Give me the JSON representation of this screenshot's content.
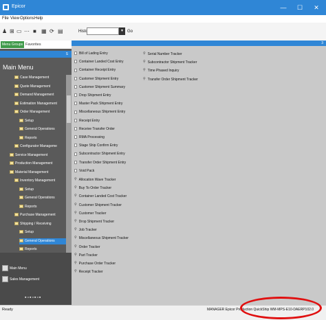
{
  "window": {
    "title": "Epicor",
    "controls": [
      "—",
      "☐",
      "✕"
    ]
  },
  "menubar": [
    "File",
    "View",
    "Options",
    "Help"
  ],
  "toolbar": {
    "icons": [
      "user-icon",
      "tree-icon",
      "window-icon",
      "dots-icon",
      "save-icon",
      "grid-icon",
      "refresh-icon",
      "clipboard-icon"
    ],
    "history_label": "History:",
    "history_value": "",
    "go_label": "Go"
  },
  "left_panel": {
    "tabs": [
      "Menu Groups",
      "Favorites"
    ],
    "blue_bar_text": "S",
    "title": "Main Menu",
    "tree": [
      {
        "label": "Case Management",
        "indent": 3,
        "selected": false
      },
      {
        "label": "Quote Management",
        "indent": 3,
        "selected": false
      },
      {
        "label": "Demand Management",
        "indent": 3,
        "selected": false
      },
      {
        "label": "Estimation Management",
        "indent": 3,
        "selected": false
      },
      {
        "label": "Order Management",
        "indent": 3,
        "selected": false
      },
      {
        "label": "Setup",
        "indent": 4,
        "selected": false
      },
      {
        "label": "General Operations",
        "indent": 4,
        "selected": false
      },
      {
        "label": "Reports",
        "indent": 4,
        "selected": false
      },
      {
        "label": "Configurator Manageme",
        "indent": 3,
        "selected": false
      },
      {
        "label": "Service Management",
        "indent": 2,
        "selected": false
      },
      {
        "label": "Production Management",
        "indent": 2,
        "selected": false
      },
      {
        "label": "Material Management",
        "indent": 2,
        "selected": false
      },
      {
        "label": "Inventory Management",
        "indent": 3,
        "selected": false
      },
      {
        "label": "Setup",
        "indent": 4,
        "selected": false
      },
      {
        "label": "General Operations",
        "indent": 4,
        "selected": false
      },
      {
        "label": "Reports",
        "indent": 4,
        "selected": false
      },
      {
        "label": "Purchase Management",
        "indent": 3,
        "selected": false
      },
      {
        "label": "Shipping / Receiving",
        "indent": 3,
        "selected": false
      },
      {
        "label": "Setup",
        "indent": 4,
        "selected": false
      },
      {
        "label": "General Operations",
        "indent": 4,
        "selected": true
      },
      {
        "label": "Reports",
        "indent": 4,
        "selected": false
      }
    ],
    "bottom_items": [
      "Main Menu",
      "Sales Management"
    ]
  },
  "right_panel": {
    "blue_bar_text": "3",
    "column1": [
      {
        "label": "Bill of Lading Entry",
        "icon": "doc"
      },
      {
        "label": "Container Landed Cost Entry",
        "icon": "doc"
      },
      {
        "label": "Container Receipt Entry",
        "icon": "doc"
      },
      {
        "label": "Customer Shipment Entry",
        "icon": "doc"
      },
      {
        "label": "Customer Shipment Summary",
        "icon": "doc"
      },
      {
        "label": "Drop Shipment Entry",
        "icon": "doc"
      },
      {
        "label": "Master Pack Shipment Entry",
        "icon": "doc"
      },
      {
        "label": "Miscellaneous Shipment Entry",
        "icon": "doc"
      },
      {
        "label": "Receipt Entry",
        "icon": "doc"
      },
      {
        "label": "Receive Transfer Order",
        "icon": "doc"
      },
      {
        "label": "RMA Processing",
        "icon": "doc"
      },
      {
        "label": "Stage Ship Confirm Entry",
        "icon": "doc"
      },
      {
        "label": "Subcontractor Shipment Entry",
        "icon": "doc"
      },
      {
        "label": "Transfer Order Shipment Entry",
        "icon": "doc"
      },
      {
        "label": "Void Pack",
        "icon": "doc"
      },
      {
        "label": "Allocation Wave Tracker",
        "icon": "search"
      },
      {
        "label": "Buy To Order Tracker",
        "icon": "search"
      },
      {
        "label": "Container Landed Cost Tracker",
        "icon": "search"
      },
      {
        "label": "Customer Shipment Tracker",
        "icon": "search"
      },
      {
        "label": "Customer Tracker",
        "icon": "search"
      },
      {
        "label": "Drop Shipment Tracker",
        "icon": "search"
      },
      {
        "label": "Job Tracker",
        "icon": "search"
      },
      {
        "label": "Miscellaneous Shipment Tracker",
        "icon": "search"
      },
      {
        "label": "Order Tracker",
        "icon": "search"
      },
      {
        "label": "Part Tracker",
        "icon": "search"
      },
      {
        "label": "Purchase Order Tracker",
        "icon": "search"
      },
      {
        "label": "Receipt Tracker",
        "icon": "search"
      }
    ],
    "column2": [
      {
        "label": "Serial Number Tracker",
        "icon": "search"
      },
      {
        "label": "Subcontractor Shipment Tracker",
        "icon": "search"
      },
      {
        "label": "Time Phased Inquiry",
        "icon": "search"
      },
      {
        "label": "Transfer Order Shipment Tracker",
        "icon": "search"
      }
    ]
  },
  "statusbar": {
    "left": "Ready",
    "right": "MANAGER  Epicor Production  QuickShip  WM-MPS-E10-DAERP102.0"
  },
  "annotation_color": "#e01010"
}
